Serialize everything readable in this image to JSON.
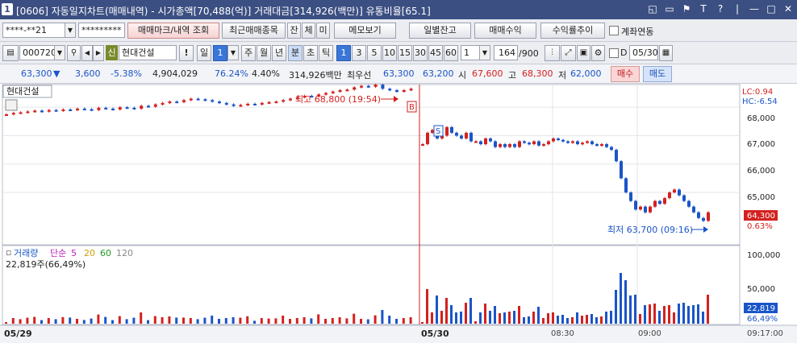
{
  "window": {
    "number": "1",
    "title": "[0606] 자동일지차트(매매내역) - 시가총액[70,488(억)] 거래대금[314,926(백만)] 유통비율[65.1]",
    "controls": [
      "◱",
      "▭",
      "⚑",
      "T",
      "?",
      "|",
      "—",
      "□",
      "✕"
    ]
  },
  "toolbar1": {
    "account": "****-**21",
    "password": "*********",
    "btn_trade_mark": "매매마크/내역 조회",
    "btn_recent": "최근매매종목",
    "btn_jan": "잔",
    "btn_che": "체",
    "btn_mi": "미",
    "btn_memo": "메모보기",
    "btn_daily": "일별잔고",
    "btn_profit": "매매수익",
    "btn_return": "수익률추이",
    "link_label": "계좌연동"
  },
  "toolbar2": {
    "code": "000720",
    "badge": "신",
    "stock_name": "현대건설",
    "alert": "!",
    "period_day": "일",
    "period_num": "1",
    "periods": [
      "주",
      "월",
      "년",
      "분",
      "초",
      "틱"
    ],
    "active_period": "분",
    "intervals": [
      "1",
      "3",
      "5",
      "10",
      "15",
      "30",
      "45",
      "60"
    ],
    "active_interval": "1",
    "custom_interval": "1",
    "count": "164",
    "count_total": "/900",
    "d_label": "D",
    "date": "05/30"
  },
  "quote": {
    "price": "63,300",
    "arrow": "▼",
    "change": "3,600",
    "change_pct": "-5.38%",
    "volume": "4,904,029",
    "vol_ratio": "76.24%",
    "turnover": "4.40%",
    "amount": "314,926백만",
    "best_label": "최우선",
    "ask": "63,300",
    "bid": "63,200",
    "open_label": "시",
    "open": "67,600",
    "high_label": "고",
    "high": "68,300",
    "low_label": "저",
    "low": "62,000",
    "buy": "매수",
    "sell": "매도"
  },
  "colors": {
    "up": "#d3211f",
    "down": "#1a55c8",
    "titlebar": "#3b4f82",
    "ma5": "#c020c0",
    "ma20": "#d0a000",
    "ma60": "#1f9a1f"
  },
  "chart_data": {
    "type": "candlestick",
    "title": "현대건설",
    "y_axis": [
      "68,000",
      "67,000",
      "66,000",
      "65,000"
    ],
    "ylim": [
      63300,
      68600
    ],
    "lc": "LC:0.94",
    "hc": "HC:-6.54",
    "high_annotation": "최고 68,800 (19:54)",
    "low_annotation": "최저 63,700 (09:16)",
    "last_price_tag": "64,300",
    "last_pct_tag": "0.63%",
    "marker_b": "B",
    "marker_s": "S",
    "x_labels": [
      "05/29",
      "05/30",
      "08:30",
      "09:00",
      "09:17:00"
    ],
    "candles_day1": [
      67750,
      67800,
      67820,
      67850,
      67880,
      67850,
      67900,
      67880,
      67920,
      67900,
      67950,
      67930,
      67900,
      67980,
      67950,
      67920,
      68000,
      67980,
      67950,
      68050,
      68020,
      68100,
      68150,
      68200,
      68180,
      68250,
      68300,
      68280,
      68250,
      68200,
      68150,
      68100,
      68050,
      68080,
      68120,
      68100,
      68150,
      68180,
      68200,
      68250,
      68300,
      68350,
      68400,
      68380,
      68450,
      68500,
      68550,
      68600,
      68620,
      68700,
      68750,
      68720,
      68800,
      68650,
      68600,
      68550,
      68600,
      68650
    ],
    "candles_day2": [
      66700,
      67100,
      67200,
      66900,
      67000,
      67300,
      67100,
      67000,
      66900,
      67100,
      66800,
      66800,
      66700,
      66900,
      66800,
      66600,
      66700,
      66600,
      66700,
      66600,
      66800,
      66750,
      66700,
      66800,
      66650,
      66700,
      66800,
      66900,
      66850,
      66800,
      66750,
      66800,
      66700,
      66750,
      66800,
      66700,
      66650,
      66700,
      66600,
      66500,
      66100,
      65500,
      65000,
      64700,
      64400,
      64500,
      64300,
      64500,
      64700,
      64600,
      64800,
      65000,
      65100,
      64900,
      64700,
      64500,
      64300,
      64100,
      64000,
      64300
    ],
    "volume_panel": {
      "label": "거래량",
      "ma_label": "단순",
      "ma_periods": [
        "5",
        "20",
        "60",
        "120"
      ],
      "current": "22,819주(66,49%)",
      "y_axis": [
        "100,000",
        "50,000"
      ],
      "tag_value": "22,819",
      "tag_pct": "66,49%"
    }
  }
}
